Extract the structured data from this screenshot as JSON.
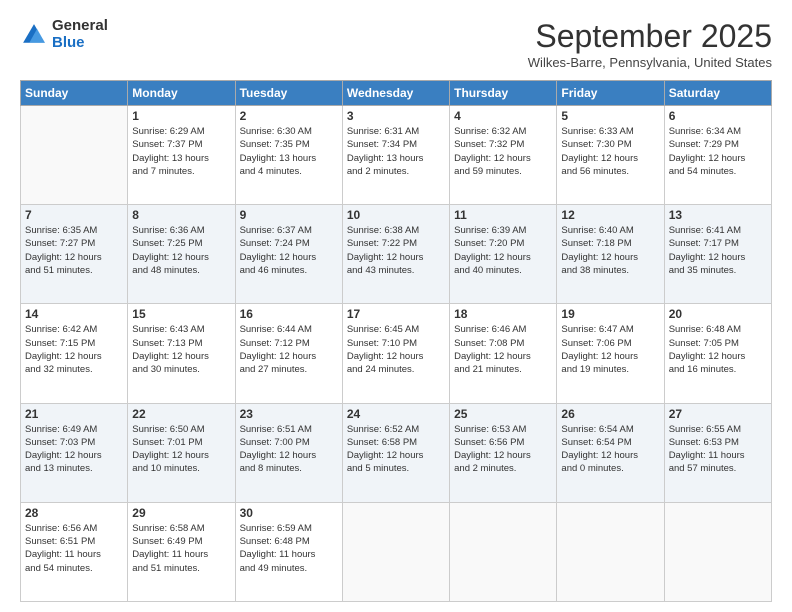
{
  "logo": {
    "general": "General",
    "blue": "Blue"
  },
  "header": {
    "month": "September 2025",
    "location": "Wilkes-Barre, Pennsylvania, United States"
  },
  "weekdays": [
    "Sunday",
    "Monday",
    "Tuesday",
    "Wednesday",
    "Thursday",
    "Friday",
    "Saturday"
  ],
  "weeks": [
    [
      {
        "day": "",
        "lines": []
      },
      {
        "day": "1",
        "lines": [
          "Sunrise: 6:29 AM",
          "Sunset: 7:37 PM",
          "Daylight: 13 hours",
          "and 7 minutes."
        ]
      },
      {
        "day": "2",
        "lines": [
          "Sunrise: 6:30 AM",
          "Sunset: 7:35 PM",
          "Daylight: 13 hours",
          "and 4 minutes."
        ]
      },
      {
        "day": "3",
        "lines": [
          "Sunrise: 6:31 AM",
          "Sunset: 7:34 PM",
          "Daylight: 13 hours",
          "and 2 minutes."
        ]
      },
      {
        "day": "4",
        "lines": [
          "Sunrise: 6:32 AM",
          "Sunset: 7:32 PM",
          "Daylight: 12 hours",
          "and 59 minutes."
        ]
      },
      {
        "day": "5",
        "lines": [
          "Sunrise: 6:33 AM",
          "Sunset: 7:30 PM",
          "Daylight: 12 hours",
          "and 56 minutes."
        ]
      },
      {
        "day": "6",
        "lines": [
          "Sunrise: 6:34 AM",
          "Sunset: 7:29 PM",
          "Daylight: 12 hours",
          "and 54 minutes."
        ]
      }
    ],
    [
      {
        "day": "7",
        "lines": [
          "Sunrise: 6:35 AM",
          "Sunset: 7:27 PM",
          "Daylight: 12 hours",
          "and 51 minutes."
        ]
      },
      {
        "day": "8",
        "lines": [
          "Sunrise: 6:36 AM",
          "Sunset: 7:25 PM",
          "Daylight: 12 hours",
          "and 48 minutes."
        ]
      },
      {
        "day": "9",
        "lines": [
          "Sunrise: 6:37 AM",
          "Sunset: 7:24 PM",
          "Daylight: 12 hours",
          "and 46 minutes."
        ]
      },
      {
        "day": "10",
        "lines": [
          "Sunrise: 6:38 AM",
          "Sunset: 7:22 PM",
          "Daylight: 12 hours",
          "and 43 minutes."
        ]
      },
      {
        "day": "11",
        "lines": [
          "Sunrise: 6:39 AM",
          "Sunset: 7:20 PM",
          "Daylight: 12 hours",
          "and 40 minutes."
        ]
      },
      {
        "day": "12",
        "lines": [
          "Sunrise: 6:40 AM",
          "Sunset: 7:18 PM",
          "Daylight: 12 hours",
          "and 38 minutes."
        ]
      },
      {
        "day": "13",
        "lines": [
          "Sunrise: 6:41 AM",
          "Sunset: 7:17 PM",
          "Daylight: 12 hours",
          "and 35 minutes."
        ]
      }
    ],
    [
      {
        "day": "14",
        "lines": [
          "Sunrise: 6:42 AM",
          "Sunset: 7:15 PM",
          "Daylight: 12 hours",
          "and 32 minutes."
        ]
      },
      {
        "day": "15",
        "lines": [
          "Sunrise: 6:43 AM",
          "Sunset: 7:13 PM",
          "Daylight: 12 hours",
          "and 30 minutes."
        ]
      },
      {
        "day": "16",
        "lines": [
          "Sunrise: 6:44 AM",
          "Sunset: 7:12 PM",
          "Daylight: 12 hours",
          "and 27 minutes."
        ]
      },
      {
        "day": "17",
        "lines": [
          "Sunrise: 6:45 AM",
          "Sunset: 7:10 PM",
          "Daylight: 12 hours",
          "and 24 minutes."
        ]
      },
      {
        "day": "18",
        "lines": [
          "Sunrise: 6:46 AM",
          "Sunset: 7:08 PM",
          "Daylight: 12 hours",
          "and 21 minutes."
        ]
      },
      {
        "day": "19",
        "lines": [
          "Sunrise: 6:47 AM",
          "Sunset: 7:06 PM",
          "Daylight: 12 hours",
          "and 19 minutes."
        ]
      },
      {
        "day": "20",
        "lines": [
          "Sunrise: 6:48 AM",
          "Sunset: 7:05 PM",
          "Daylight: 12 hours",
          "and 16 minutes."
        ]
      }
    ],
    [
      {
        "day": "21",
        "lines": [
          "Sunrise: 6:49 AM",
          "Sunset: 7:03 PM",
          "Daylight: 12 hours",
          "and 13 minutes."
        ]
      },
      {
        "day": "22",
        "lines": [
          "Sunrise: 6:50 AM",
          "Sunset: 7:01 PM",
          "Daylight: 12 hours",
          "and 10 minutes."
        ]
      },
      {
        "day": "23",
        "lines": [
          "Sunrise: 6:51 AM",
          "Sunset: 7:00 PM",
          "Daylight: 12 hours",
          "and 8 minutes."
        ]
      },
      {
        "day": "24",
        "lines": [
          "Sunrise: 6:52 AM",
          "Sunset: 6:58 PM",
          "Daylight: 12 hours",
          "and 5 minutes."
        ]
      },
      {
        "day": "25",
        "lines": [
          "Sunrise: 6:53 AM",
          "Sunset: 6:56 PM",
          "Daylight: 12 hours",
          "and 2 minutes."
        ]
      },
      {
        "day": "26",
        "lines": [
          "Sunrise: 6:54 AM",
          "Sunset: 6:54 PM",
          "Daylight: 12 hours",
          "and 0 minutes."
        ]
      },
      {
        "day": "27",
        "lines": [
          "Sunrise: 6:55 AM",
          "Sunset: 6:53 PM",
          "Daylight: 11 hours",
          "and 57 minutes."
        ]
      }
    ],
    [
      {
        "day": "28",
        "lines": [
          "Sunrise: 6:56 AM",
          "Sunset: 6:51 PM",
          "Daylight: 11 hours",
          "and 54 minutes."
        ]
      },
      {
        "day": "29",
        "lines": [
          "Sunrise: 6:58 AM",
          "Sunset: 6:49 PM",
          "Daylight: 11 hours",
          "and 51 minutes."
        ]
      },
      {
        "day": "30",
        "lines": [
          "Sunrise: 6:59 AM",
          "Sunset: 6:48 PM",
          "Daylight: 11 hours",
          "and 49 minutes."
        ]
      },
      {
        "day": "",
        "lines": []
      },
      {
        "day": "",
        "lines": []
      },
      {
        "day": "",
        "lines": []
      },
      {
        "day": "",
        "lines": []
      }
    ]
  ]
}
